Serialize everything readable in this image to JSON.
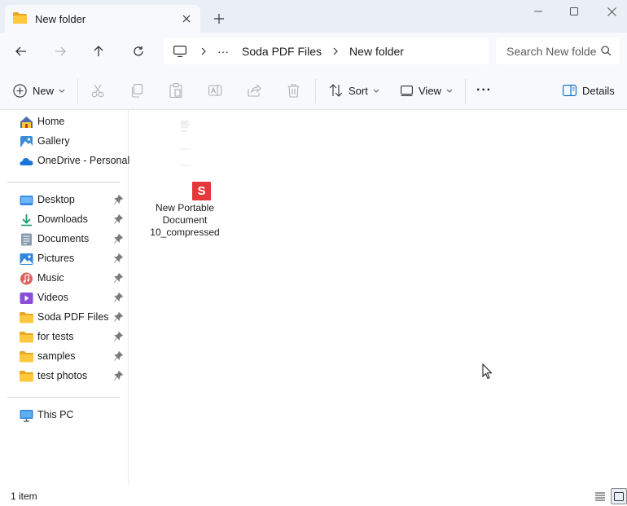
{
  "window": {
    "tab_title": "New folder",
    "new_tab_label": "+"
  },
  "navigation": {
    "breadcrumb": {
      "ellipsis": "···",
      "items": [
        "Soda PDF Files",
        "New folder"
      ]
    },
    "search": {
      "placeholder": "Search New folder"
    }
  },
  "toolbar": {
    "new_label": "New",
    "sort_label": "Sort",
    "view_label": "View",
    "more_label": "···",
    "details_label": "Details"
  },
  "sidebar": {
    "quick": [
      {
        "label": "Home",
        "icon": "home-icon"
      },
      {
        "label": "Gallery",
        "icon": "gallery-icon"
      },
      {
        "label": "OneDrive - Personal",
        "icon": "onedrive-icon"
      }
    ],
    "pinned": [
      {
        "label": "Desktop",
        "icon": "desktop-icon"
      },
      {
        "label": "Downloads",
        "icon": "downloads-icon"
      },
      {
        "label": "Documents",
        "icon": "documents-icon"
      },
      {
        "label": "Pictures",
        "icon": "pictures-icon"
      },
      {
        "label": "Music",
        "icon": "music-icon"
      },
      {
        "label": "Videos",
        "icon": "videos-icon"
      },
      {
        "label": "Soda PDF Files",
        "icon": "folder-icon"
      },
      {
        "label": "for tests",
        "icon": "folder-icon"
      },
      {
        "label": "samples",
        "icon": "folder-icon"
      },
      {
        "label": "test photos",
        "icon": "folder-icon"
      }
    ],
    "this_pc": {
      "label": "This PC",
      "icon": "this-pc-icon"
    }
  },
  "content": {
    "files": [
      {
        "name": "New Portable Document 10_compressed",
        "badge": "S",
        "icon": "soda-pdf-file-icon"
      }
    ]
  },
  "status": {
    "item_count": "1 item"
  },
  "colors": {
    "badge": "#e5383b",
    "folder": "#ffc83d",
    "accent": "#0067c0"
  }
}
